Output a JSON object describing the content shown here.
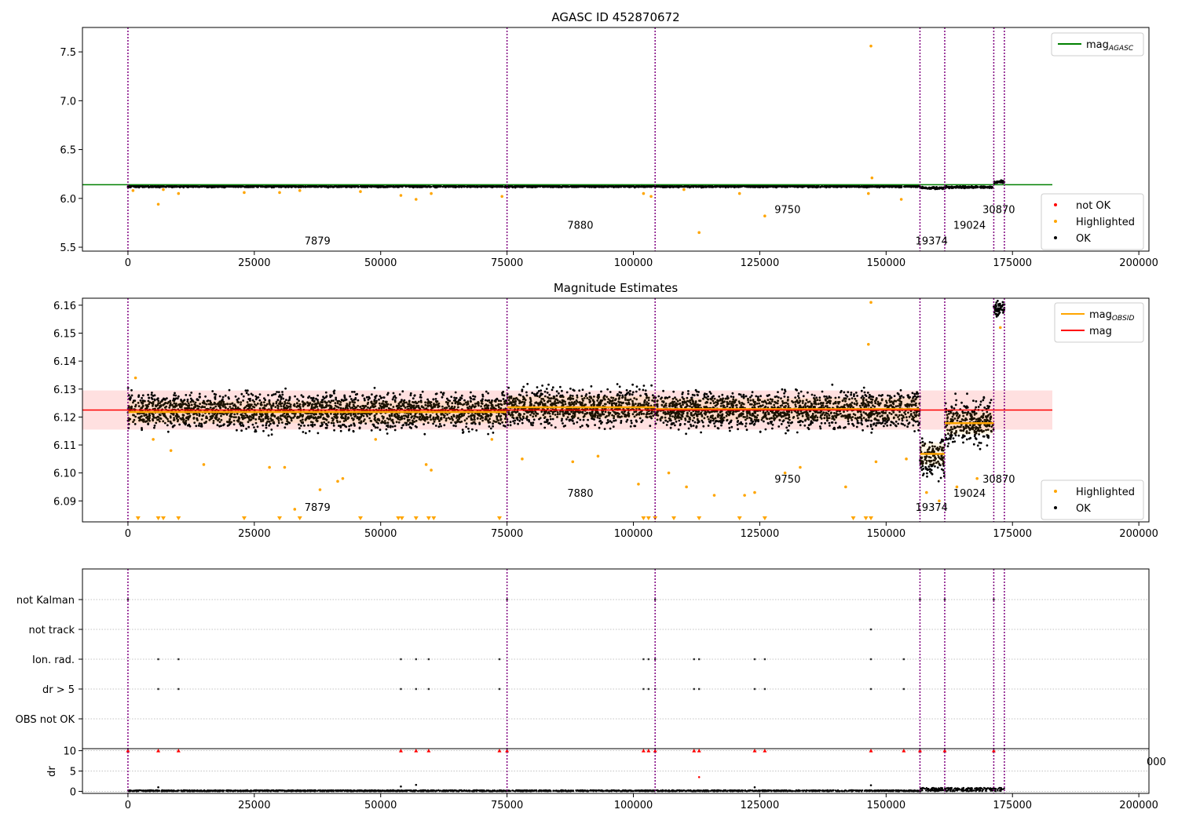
{
  "chart_data": [
    {
      "type": "scatter",
      "title": "AGASC ID 452870672",
      "xlim": [
        -9000,
        202000
      ],
      "ylim": [
        5.46,
        7.75
      ],
      "x_ticks": [
        0,
        25000,
        50000,
        75000,
        100000,
        125000,
        150000,
        175000,
        200000
      ],
      "y_ticks": [
        5.5,
        6.0,
        6.5,
        7.0,
        7.5
      ],
      "legends": [
        {
          "position": "top-right",
          "entries": [
            {
              "label": "mag",
              "sub": "AGASC",
              "color": "#008000",
              "kind": "line"
            }
          ]
        },
        {
          "position": "bottom-right",
          "entries": [
            {
              "label": "not OK",
              "color": "#ff0000",
              "kind": "dot"
            },
            {
              "label": "Highlighted",
              "color": "#ffa500",
              "kind": "dot"
            },
            {
              "label": "OK",
              "color": "#000000",
              "kind": "dot"
            }
          ]
        }
      ],
      "mag_agasc": 6.14,
      "obs_boundaries": [
        0,
        75000,
        104300,
        156700,
        161600,
        171300,
        173400
      ],
      "obsid_labels": [
        {
          "text": "7879",
          "x": 37500,
          "y": 5.53
        },
        {
          "text": "7880",
          "x": 89500,
          "y": 5.69
        },
        {
          "text": "9750",
          "x": 130500,
          "y": 5.85
        },
        {
          "text": "19374",
          "x": 159000,
          "y": 5.53
        },
        {
          "text": "19024",
          "x": 166500,
          "y": 5.69
        },
        {
          "text": "30870",
          "x": 172300,
          "y": 5.85
        }
      ],
      "ok_segments": [
        {
          "x0": 0,
          "x1": 156700,
          "y0": 6.11,
          "y1": 6.135
        },
        {
          "x0": 156700,
          "x1": 161600,
          "y0": 6.09,
          "y1": 6.12
        },
        {
          "x0": 161600,
          "x1": 171300,
          "y0": 6.1,
          "y1": 6.13
        },
        {
          "x0": 171300,
          "x1": 173400,
          "y0": 6.15,
          "y1": 6.19
        }
      ],
      "highlighted_points": [
        [
          1000,
          6.08
        ],
        [
          6000,
          5.94
        ],
        [
          7000,
          6.09
        ],
        [
          10000,
          6.05
        ],
        [
          23000,
          6.06
        ],
        [
          30000,
          6.06
        ],
        [
          34000,
          6.08
        ],
        [
          46000,
          6.07
        ],
        [
          54000,
          6.03
        ],
        [
          57000,
          5.99
        ],
        [
          60000,
          6.05
        ],
        [
          74000,
          6.02
        ],
        [
          102000,
          6.05
        ],
        [
          103500,
          6.02
        ],
        [
          110000,
          6.09
        ],
        [
          113000,
          5.65
        ],
        [
          121000,
          6.05
        ],
        [
          126000,
          5.82
        ],
        [
          146500,
          6.05
        ],
        [
          147000,
          7.56
        ],
        [
          147200,
          6.21
        ],
        [
          153000,
          5.99
        ]
      ]
    },
    {
      "type": "scatter",
      "title": "Magnitude Estimates",
      "xlim": [
        -9000,
        202000
      ],
      "ylim": [
        6.0825,
        6.1625
      ],
      "x_ticks": [
        0,
        25000,
        50000,
        75000,
        100000,
        125000,
        150000,
        175000,
        200000
      ],
      "y_ticks": [
        6.09,
        6.1,
        6.11,
        6.12,
        6.13,
        6.14,
        6.15,
        6.16
      ],
      "legends": [
        {
          "position": "top-right",
          "entries": [
            {
              "label": "mag",
              "sub": "OBSID",
              "color": "#ffa500",
              "kind": "line"
            },
            {
              "label": "mag",
              "sub": "",
              "color": "#ff0000",
              "kind": "line"
            }
          ]
        },
        {
          "position": "bottom-right",
          "entries": [
            {
              "label": "Highlighted",
              "color": "#ffa500",
              "kind": "dot"
            },
            {
              "label": "OK",
              "color": "#000000",
              "kind": "dot"
            }
          ]
        }
      ],
      "mag": 6.1225,
      "mag_band": [
        6.1155,
        6.1295
      ],
      "obs_boundaries": [
        0,
        75000,
        104300,
        156700,
        161600,
        171300,
        173400
      ],
      "obsid_mags": [
        {
          "x0": 0,
          "x1": 75000,
          "mag": 6.1218
        },
        {
          "x0": 75000,
          "x1": 104300,
          "mag": 6.1235
        },
        {
          "x0": 104300,
          "x1": 156700,
          "mag": 6.1228
        },
        {
          "x0": 156700,
          "x1": 161600,
          "mag": 6.1068
        },
        {
          "x0": 161600,
          "x1": 171300,
          "mag": 6.1178
        }
      ],
      "obsid_labels": [
        {
          "text": "7879",
          "x": 37500,
          "y": 6.0865
        },
        {
          "text": "7880",
          "x": 89500,
          "y": 6.0915
        },
        {
          "text": "9750",
          "x": 130500,
          "y": 6.0965
        },
        {
          "text": "19374",
          "x": 159000,
          "y": 6.0865
        },
        {
          "text": "19024",
          "x": 166500,
          "y": 6.0915
        },
        {
          "text": "30870",
          "x": 172300,
          "y": 6.0965
        }
      ],
      "ok_segments": [
        {
          "x0": 0,
          "x1": 75000,
          "y0": 6.113,
          "y1": 6.131
        },
        {
          "x0": 75000,
          "x1": 104300,
          "y0": 6.114,
          "y1": 6.133
        },
        {
          "x0": 104300,
          "x1": 156700,
          "y0": 6.113,
          "y1": 6.132
        },
        {
          "x0": 156700,
          "x1": 161600,
          "y0": 6.095,
          "y1": 6.115
        },
        {
          "x0": 161600,
          "x1": 171300,
          "y0": 6.105,
          "y1": 6.131
        },
        {
          "x0": 171300,
          "x1": 173400,
          "y0": 6.155,
          "y1": 6.162
        }
      ],
      "highlighted_points": [
        [
          1500,
          6.134
        ],
        [
          5000,
          6.112
        ],
        [
          8500,
          6.108
        ],
        [
          15000,
          6.103
        ],
        [
          28000,
          6.102
        ],
        [
          31000,
          6.102
        ],
        [
          33000,
          6.087
        ],
        [
          38000,
          6.094
        ],
        [
          41500,
          6.097
        ],
        [
          42500,
          6.098
        ],
        [
          49000,
          6.112
        ],
        [
          59000,
          6.103
        ],
        [
          60000,
          6.101
        ],
        [
          72000,
          6.112
        ],
        [
          78000,
          6.105
        ],
        [
          88000,
          6.104
        ],
        [
          93000,
          6.106
        ],
        [
          101000,
          6.096
        ],
        [
          107000,
          6.1
        ],
        [
          110500,
          6.095
        ],
        [
          116000,
          6.092
        ],
        [
          122000,
          6.092
        ],
        [
          124000,
          6.093
        ],
        [
          130000,
          6.1
        ],
        [
          133000,
          6.102
        ],
        [
          142000,
          6.095
        ],
        [
          146500,
          6.146
        ],
        [
          147000,
          6.161
        ],
        [
          148000,
          6.104
        ],
        [
          154000,
          6.105
        ],
        [
          158000,
          6.093
        ],
        [
          160500,
          6.09
        ],
        [
          164000,
          6.095
        ],
        [
          168000,
          6.098
        ],
        [
          172600,
          6.152
        ]
      ],
      "below_range_markers": [
        2000,
        6000,
        7000,
        10000,
        23000,
        30000,
        34000,
        46000,
        53500,
        54200,
        57000,
        59500,
        60500,
        73500,
        102000,
        103000,
        104300,
        108000,
        113000,
        121000,
        126000,
        143500,
        146000,
        147000
      ]
    },
    {
      "type": "scatter",
      "ylabel": "",
      "xlim": [
        -9000,
        202000
      ],
      "categories": [
        "not Kalman",
        "not track",
        "Ion. rad.",
        "dr > 5",
        "OBS not OK"
      ],
      "obs_boundaries": [
        0,
        75000,
        104300,
        156700,
        161600,
        171300,
        173400
      ],
      "flag_points": {
        "not Kalman": [
          0,
          75000,
          104300,
          156700,
          161600,
          171300
        ],
        "not track": [
          147000
        ],
        "Ion. rad.": [
          6000,
          10000,
          54000,
          57000,
          59500,
          73500,
          102000,
          103000,
          104300,
          112000,
          113000,
          124000,
          126000,
          147000,
          153500
        ],
        "dr > 5": [
          6000,
          10000,
          54000,
          57000,
          59500,
          73500,
          102000,
          103000,
          104300,
          112000,
          113000,
          124000,
          126000,
          147000,
          153500
        ],
        "OBS not OK": []
      }
    },
    {
      "type": "scatter",
      "ylabel": "dr",
      "xlim": [
        -9000,
        202000
      ],
      "ylim": [
        -0.5,
        10.5
      ],
      "x_ticks": [
        0,
        25000,
        50000,
        75000,
        100000,
        125000,
        150000,
        175000,
        200000
      ],
      "y_ticks": [
        0,
        5,
        10
      ],
      "stray_tick_label": "000",
      "obs_boundaries": [
        0,
        75000,
        104300,
        156700,
        161600,
        171300,
        173400
      ],
      "dr_capped": [
        0,
        6000,
        10000,
        54000,
        57000,
        59500,
        73500,
        75000,
        102000,
        103000,
        104300,
        112000,
        113000,
        124000,
        126000,
        147000,
        153500,
        156700,
        161600,
        171300
      ],
      "dr_points": [
        [
          6000,
          1.0
        ],
        [
          54000,
          1.2
        ],
        [
          57000,
          1.6
        ],
        [
          113000,
          3.5
        ],
        [
          124000,
          1.0
        ],
        [
          147000,
          1.5
        ]
      ],
      "dr_band_segments": [
        {
          "x0": 0,
          "x1": 156700,
          "y0": 0,
          "y1": 0.3
        },
        {
          "x0": 156700,
          "x1": 173400,
          "y0": 0,
          "y1": 0.9
        }
      ]
    }
  ]
}
